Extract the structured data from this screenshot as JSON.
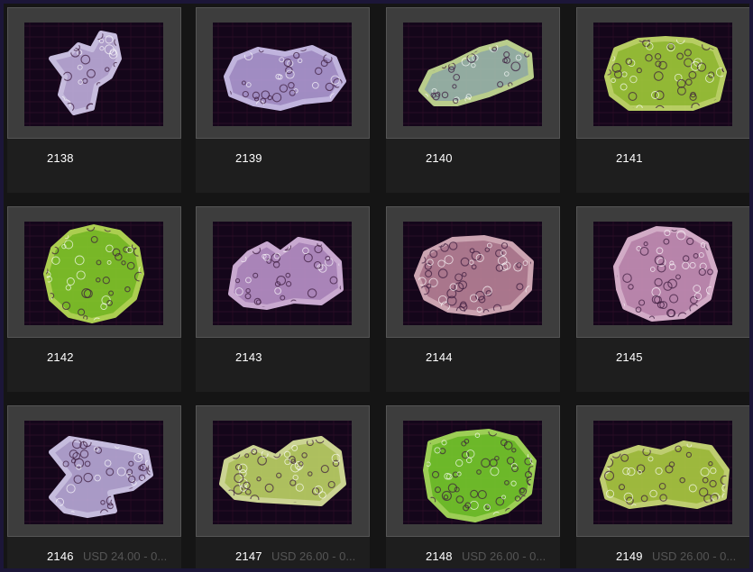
{
  "products": [
    {
      "sku": "2138",
      "price": "",
      "coral_color": "#c9b8e8",
      "glow": "#e6dcff"
    },
    {
      "sku": "2139",
      "price": "",
      "coral_color": "#b9a4e0",
      "glow": "#ded3ff"
    },
    {
      "sku": "2140",
      "price": "",
      "coral_color": "#a9c8b8",
      "glow": "#d6f0a0"
    },
    {
      "sku": "2141",
      "price": "",
      "coral_color": "#a8d83a",
      "glow": "#d4f070"
    },
    {
      "sku": "2142",
      "price": "",
      "coral_color": "#8ad62a",
      "glow": "#c6f25a"
    },
    {
      "sku": "2143",
      "price": "",
      "coral_color": "#c49ad4",
      "glow": "#e8c6f0"
    },
    {
      "sku": "2144",
      "price": "",
      "coral_color": "#c48aa0",
      "glow": "#ecc0cc"
    },
    {
      "sku": "2145",
      "price": "",
      "coral_color": "#d49ac4",
      "glow": "#f2c8e4"
    },
    {
      "sku": "2146",
      "price": "USD 24.00 - 0...",
      "coral_color": "#c4b4e4",
      "glow": "#e4dcff"
    },
    {
      "sku": "2147",
      "price": "USD 26.00 - 0...",
      "coral_color": "#c8e06a",
      "glow": "#ecf8a8"
    },
    {
      "sku": "2148",
      "price": "USD 26.00 - 0...",
      "coral_color": "#7cd82c",
      "glow": "#b4f260"
    },
    {
      "sku": "2149",
      "price": "USD 26.00 - 0...",
      "coral_color": "#b6d844",
      "glow": "#dcf080"
    }
  ],
  "colors": {
    "background": "#151515",
    "card": "#232323",
    "photo_frame": "#3d3d3d",
    "photo_bg": "#100410",
    "window_border": "#1c1638"
  }
}
